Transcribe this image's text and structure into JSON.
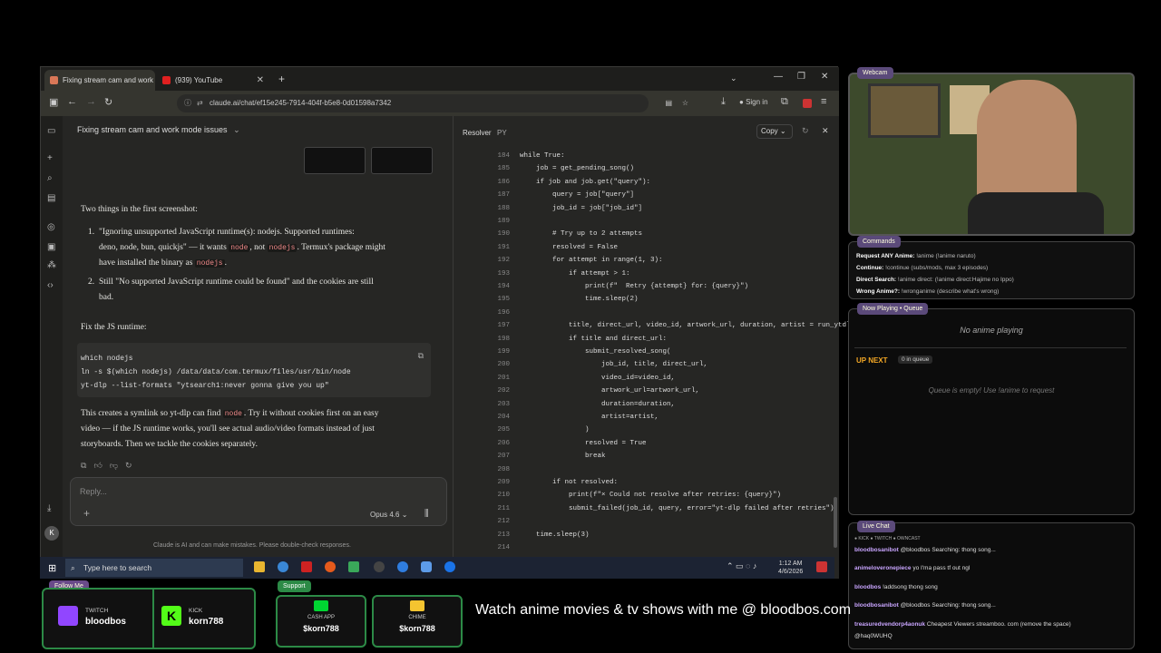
{
  "browser": {
    "tabs": [
      {
        "label": "Fixing stream cam and work m...",
        "active": true
      },
      {
        "label": "(939) YouTube",
        "active": false
      }
    ],
    "url": "claude.ai/chat/ef15e245-7914-404f-b5e8-0d01598a7342",
    "signin": "Sign in"
  },
  "chat": {
    "title": "Fixing stream cam and work mode issues",
    "intro": "Two things in the first screenshot:",
    "item1_a": "\"Ignoring unsupported JavaScript runtime(s): nodejs. Supported runtimes:",
    "item1_b1": "deno, node, bun, quickjs\" — it wants ",
    "item1_code1": "node",
    "item1_b2": ", not ",
    "item1_code2": "nodejs",
    "item1_b3": ". Termux's package might",
    "item1_c1": "have installed the binary as ",
    "item1_code3": "nodejs",
    "item1_c2": ".",
    "item2_a": "Still \"No supported JavaScript runtime could be found\" and the cookies are still",
    "item2_b": "bad.",
    "fix_heading": "Fix the JS runtime:",
    "code_lines": [
      "which nodejs",
      "ln -s $(which nodejs) /data/data/com.termux/files/usr/bin/node",
      "yt-dlp --list-formats \"ytsearch1:never gonna give you up\""
    ],
    "outro_1a": "This creates a symlink so yt-dlp can find ",
    "outro_code": "node",
    "outro_1b": ". Try it without cookies first on an easy",
    "outro_2": "video — if the JS runtime works, you'll see actual audio/video formats instead of just",
    "outro_3": "storyboards. Then we tackle the cookies separately.",
    "reply_placeholder": "Reply...",
    "model": "Opus 4.6",
    "disclaimer": "Claude is AI and can make mistakes. Please double-check responses.",
    "avatar": "K"
  },
  "codepanel": {
    "title": "Resolver",
    "lang": "PY",
    "copy": "Copy",
    "lines": [
      {
        "n": "184",
        "code": "while True:"
      },
      {
        "n": "185",
        "code": "    job = get_pending_song()"
      },
      {
        "n": "186",
        "code": "    if job and job.get(\"query\"):"
      },
      {
        "n": "187",
        "code": "        query = job[\"query\"]"
      },
      {
        "n": "188",
        "code": "        job_id = job[\"job_id\"]"
      },
      {
        "n": "189",
        "code": ""
      },
      {
        "n": "190",
        "code": "        # Try up to 2 attempts"
      },
      {
        "n": "191",
        "code": "        resolved = False"
      },
      {
        "n": "192",
        "code": "        for attempt in range(1, 3):"
      },
      {
        "n": "193",
        "code": "            if attempt > 1:"
      },
      {
        "n": "194",
        "code": "                print(f\"  Retry {attempt} for: {query}\")"
      },
      {
        "n": "195",
        "code": "                time.sleep(2)"
      },
      {
        "n": "196",
        "code": ""
      },
      {
        "n": "197",
        "code": "            title, direct_url, video_id, artwork_url, duration, artist = run_ytdlp(query)"
      },
      {
        "n": "198",
        "code": "            if title and direct_url:"
      },
      {
        "n": "199",
        "code": "                submit_resolved_song("
      },
      {
        "n": "200",
        "code": "                    job_id, title, direct_url,"
      },
      {
        "n": "201",
        "code": "                    video_id=video_id,"
      },
      {
        "n": "202",
        "code": "                    artwork_url=artwork_url,"
      },
      {
        "n": "203",
        "code": "                    duration=duration,"
      },
      {
        "n": "204",
        "code": "                    artist=artist,"
      },
      {
        "n": "205",
        "code": "                )"
      },
      {
        "n": "206",
        "code": "                resolved = True"
      },
      {
        "n": "207",
        "code": "                break"
      },
      {
        "n": "208",
        "code": ""
      },
      {
        "n": "209",
        "code": "        if not resolved:"
      },
      {
        "n": "210",
        "code": "            print(f\"× Could not resolve after retries: {query}\")"
      },
      {
        "n": "211",
        "code": "            submit_failed(job_id, query, error=\"yt-dlp failed after retries\")"
      },
      {
        "n": "212",
        "code": ""
      },
      {
        "n": "213",
        "code": "    time.sleep(3)"
      },
      {
        "n": "214",
        "code": ""
      }
    ]
  },
  "taskbar": {
    "search": "Type here to search",
    "time": "1:12 AM",
    "date": "4/6/2026"
  },
  "overlay": {
    "webcam_label": "Webcam",
    "commands_label": "Commands",
    "commands": [
      {
        "key": "Request ANY Anime:",
        "val": " !anime   (!anime naruto)"
      },
      {
        "key": "Continue:",
        "val": " !continue   (subs/mods, max 3 episodes)"
      },
      {
        "key": "Direct Search:",
        "val": " !anime direct:  (!anime direct:Hajime no Ippo)"
      },
      {
        "key": "Wrong Anime?:",
        "val": " !wronganime   (describe what's wrong)"
      }
    ],
    "nowplaying_label": "Now Playing • Queue",
    "no_anime": "No anime playing",
    "up_next": "UP NEXT",
    "queue_count": "0 in queue",
    "queue_empty": "Queue is empty! Use !anime to request",
    "livechat_label": "Live Chat",
    "platforms": "● KICK  ● TWITCH  ● OWNCAST",
    "chat": [
      {
        "user": "bloodbosanibot",
        "msg": "@bloodbos Searching: thong song..."
      },
      {
        "user": "animeloveronepiece",
        "msg": "yo I'ma pass tf out ngl"
      },
      {
        "user": "bloodbos",
        "msg": "!addsong thong song"
      },
      {
        "user": "bloodbosanibot",
        "msg": "@bloodbos Searching: thong song..."
      },
      {
        "user": "treasuredvendorp4aonuk",
        "msg": "Cheapest Viewers streamboo. com (remove the space)"
      },
      {
        "user": "",
        "msg": "@haq0WUHQ"
      }
    ],
    "follow_label": "Follow Me",
    "twitch_label": "TWITCH",
    "twitch_user": "bloodbos",
    "kick_label": "KICK",
    "kick_user": "korn788",
    "support_label": "Support",
    "cashapp_label": "CASH APP",
    "cashapp_user": "$korn788",
    "chime_label": "CHIME",
    "chime_user": "$korn788",
    "ticker": "Watch anime movies & tv shows with me @ bloodbos.com"
  }
}
